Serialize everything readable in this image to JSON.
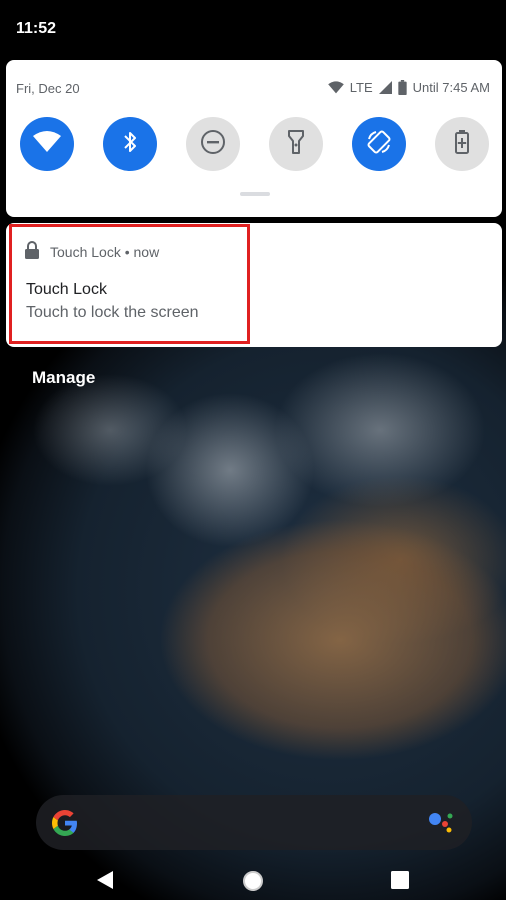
{
  "status_bar": {
    "time": "11:52"
  },
  "quick_settings": {
    "date": "Fri, Dec 20",
    "network": "LTE",
    "battery_text": "Until 7:45 AM",
    "tiles": [
      {
        "name": "wifi",
        "state": "on",
        "icon": "wifi-icon"
      },
      {
        "name": "bluetooth",
        "state": "on",
        "icon": "bluetooth-icon"
      },
      {
        "name": "do-not-disturb",
        "state": "off",
        "icon": "do-not-disturb-icon"
      },
      {
        "name": "flashlight",
        "state": "off",
        "icon": "flashlight-icon"
      },
      {
        "name": "auto-rotate",
        "state": "on",
        "icon": "auto-rotate-icon"
      },
      {
        "name": "battery-saver",
        "state": "off",
        "icon": "battery-saver-icon"
      }
    ]
  },
  "notification": {
    "app_name": "Touch Lock",
    "time": "now",
    "title": "Touch Lock",
    "text": "Touch to lock the screen",
    "highlight_color": "#e02020"
  },
  "manage_label": "Manage",
  "colors": {
    "accent": "#1a73e8",
    "tile_off": "#e0e0e0"
  }
}
